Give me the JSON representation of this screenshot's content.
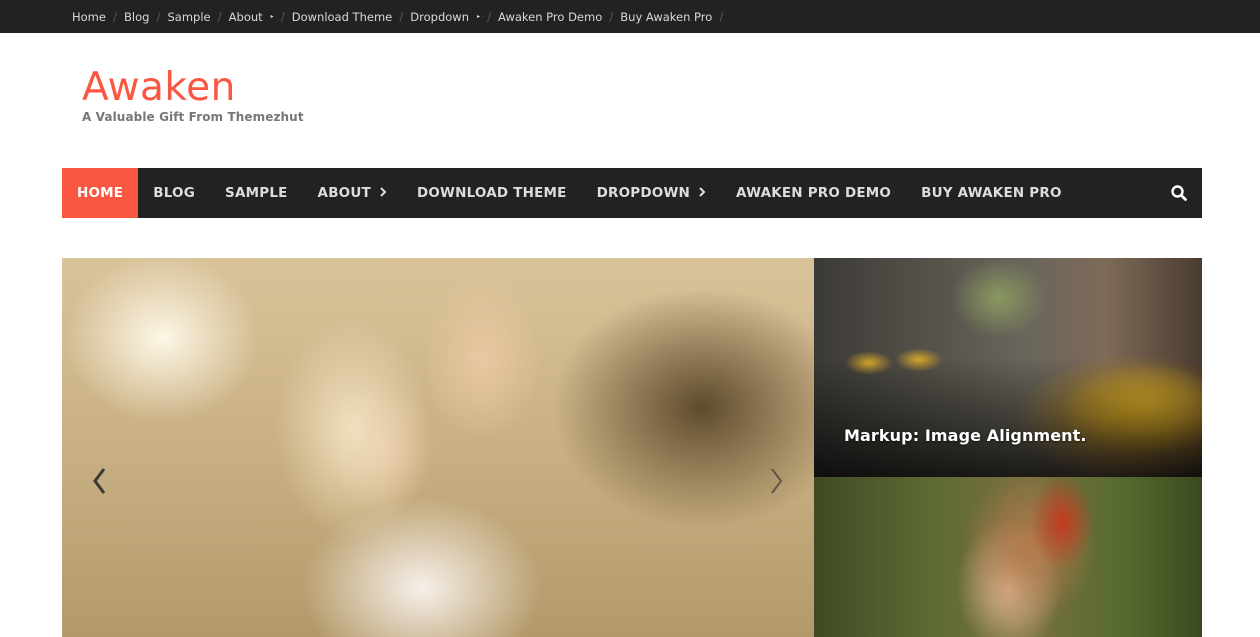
{
  "top_menu": {
    "items": [
      {
        "label": "Home",
        "has_submenu": false
      },
      {
        "label": "Blog",
        "has_submenu": false
      },
      {
        "label": "Sample",
        "has_submenu": false
      },
      {
        "label": "About",
        "has_submenu": true
      },
      {
        "label": "Download Theme",
        "has_submenu": false
      },
      {
        "label": "Dropdown",
        "has_submenu": true
      },
      {
        "label": "Awaken Pro Demo",
        "has_submenu": false
      },
      {
        "label": "Buy Awaken Pro",
        "has_submenu": false
      }
    ],
    "separator": "/",
    "submenu_caret": "▸"
  },
  "branding": {
    "site_title": "Awaken",
    "site_description": "A Valuable Gift From Themezhut"
  },
  "main_menu": {
    "items": [
      {
        "label": "HOME",
        "active": true,
        "has_submenu": false
      },
      {
        "label": "BLOG",
        "active": false,
        "has_submenu": false
      },
      {
        "label": "SAMPLE",
        "active": false,
        "has_submenu": false
      },
      {
        "label": "ABOUT",
        "active": false,
        "has_submenu": true
      },
      {
        "label": "DOWNLOAD THEME",
        "active": false,
        "has_submenu": false
      },
      {
        "label": "DROPDOWN",
        "active": false,
        "has_submenu": true
      },
      {
        "label": "AWAKEN PRO DEMO",
        "active": false,
        "has_submenu": false
      },
      {
        "label": "BUY AWAKEN PRO",
        "active": false,
        "has_submenu": false
      }
    ],
    "chevron": "›",
    "search_icon": "search-icon"
  },
  "featured": {
    "slider": {
      "image": "two-girls-photo",
      "prev_icon": "chevron-left-icon",
      "next_icon": "chevron-right-icon"
    },
    "side_posts": [
      {
        "image": "yellow-taxi-street-photo",
        "caption": "Markup: Image Alignment."
      },
      {
        "image": "girl-with-bandana-photo",
        "caption": ""
      }
    ]
  },
  "colors": {
    "accent": "#fa5742",
    "nav_background": "#222222",
    "tagline": "#777777"
  }
}
